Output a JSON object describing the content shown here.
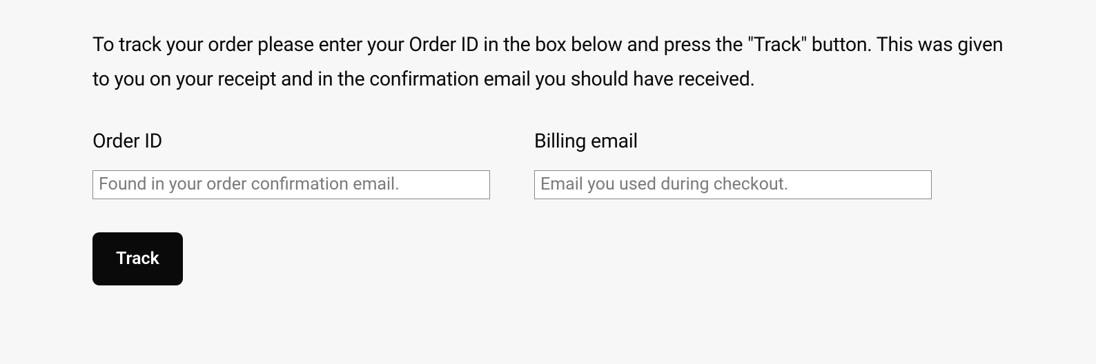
{
  "instructions": "To track your order please enter your Order ID in the box below and press the \"Track\" button. This was given to you on your receipt and in the confirmation email you should have received.",
  "form": {
    "order_id": {
      "label": "Order ID",
      "placeholder": "Found in your order confirmation email.",
      "value": ""
    },
    "billing_email": {
      "label": "Billing email",
      "placeholder": "Email you used during checkout.",
      "value": ""
    },
    "submit_label": "Track"
  }
}
